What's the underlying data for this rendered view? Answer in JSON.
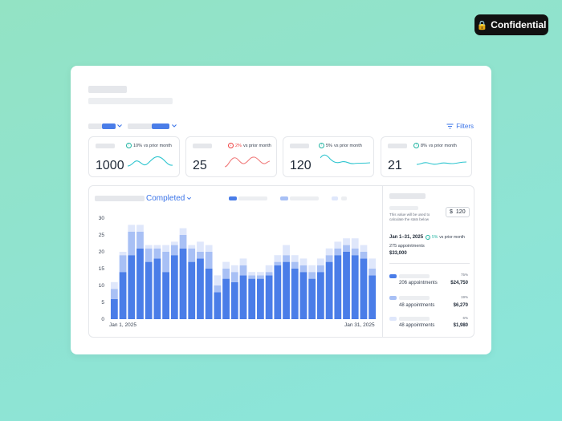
{
  "badge": {
    "label": "Confidential"
  },
  "toolbar": {
    "filters_label": "Filters"
  },
  "stats": [
    {
      "change": "10%",
      "direction": "up",
      "suffix": "vs prior month",
      "value": "1000",
      "color": "#2ec5cf"
    },
    {
      "change": "2%",
      "direction": "down",
      "suffix": "vs prior month",
      "value": "25",
      "color": "#f07b7b"
    },
    {
      "change": "5%",
      "direction": "up",
      "suffix": "vs prior month",
      "value": "120",
      "color": "#2ec5cf"
    },
    {
      "change": "8%",
      "direction": "up",
      "suffix": "vs prior month",
      "value": "21",
      "color": "#2ec5cf"
    }
  ],
  "chart_panel": {
    "status_dropdown": "Completed",
    "x_start": "Jan 1, 2025",
    "x_end": "Jan 31, 2025"
  },
  "chart_data": {
    "type": "bar",
    "stacked": true,
    "ylim": [
      0,
      30
    ],
    "yticks": [
      0,
      5,
      10,
      15,
      20,
      25,
      30
    ],
    "x_first_label": "Jan 1, 2025",
    "x_last_label": "Jan 31, 2025",
    "colors": [
      "#4a7de8",
      "#a8c0f5",
      "#dfe7fb"
    ],
    "series": [
      {
        "values": [
          6,
          14,
          19,
          21,
          17,
          18,
          14,
          19,
          21,
          17,
          18,
          15,
          8,
          12,
          11,
          13,
          12,
          12,
          13,
          16,
          17,
          15,
          14,
          12,
          14,
          17,
          19,
          20,
          19,
          18,
          13
        ]
      },
      {
        "values": [
          3,
          5,
          7,
          5,
          4,
          3,
          6,
          3,
          4,
          4,
          2,
          5,
          2,
          3,
          3,
          3,
          1,
          1,
          1,
          1,
          2,
          2,
          2,
          2,
          2,
          2,
          2,
          2,
          2,
          2,
          2
        ]
      },
      {
        "values": [
          2,
          1,
          2,
          2,
          1,
          1,
          2,
          1,
          2,
          1,
          3,
          2,
          3,
          2,
          2,
          2,
          1,
          1,
          2,
          2,
          3,
          2,
          2,
          2,
          2,
          2,
          2,
          2,
          3,
          2,
          3
        ]
      }
    ]
  },
  "side_panel": {
    "note": "This value will be used to calculate the stats below",
    "currency_symbol": "$",
    "input_value": "120",
    "range_label": "Jan 1–31, 2025",
    "range_change": "5%",
    "range_suffix": "vs prior month",
    "appointments_total": "275 appointments",
    "amount_total": "$33,000",
    "rows": [
      {
        "pct": "75%",
        "count": "206 appointments",
        "amount": "$24,750",
        "color": "#4a7de8"
      },
      {
        "pct": "19%",
        "count": "48 appointments",
        "amount": "$6,270",
        "color": "#a8c0f5"
      },
      {
        "pct": "6%",
        "count": "48 appointments",
        "amount": "$1,980",
        "color": "#dfe7fb"
      }
    ]
  }
}
